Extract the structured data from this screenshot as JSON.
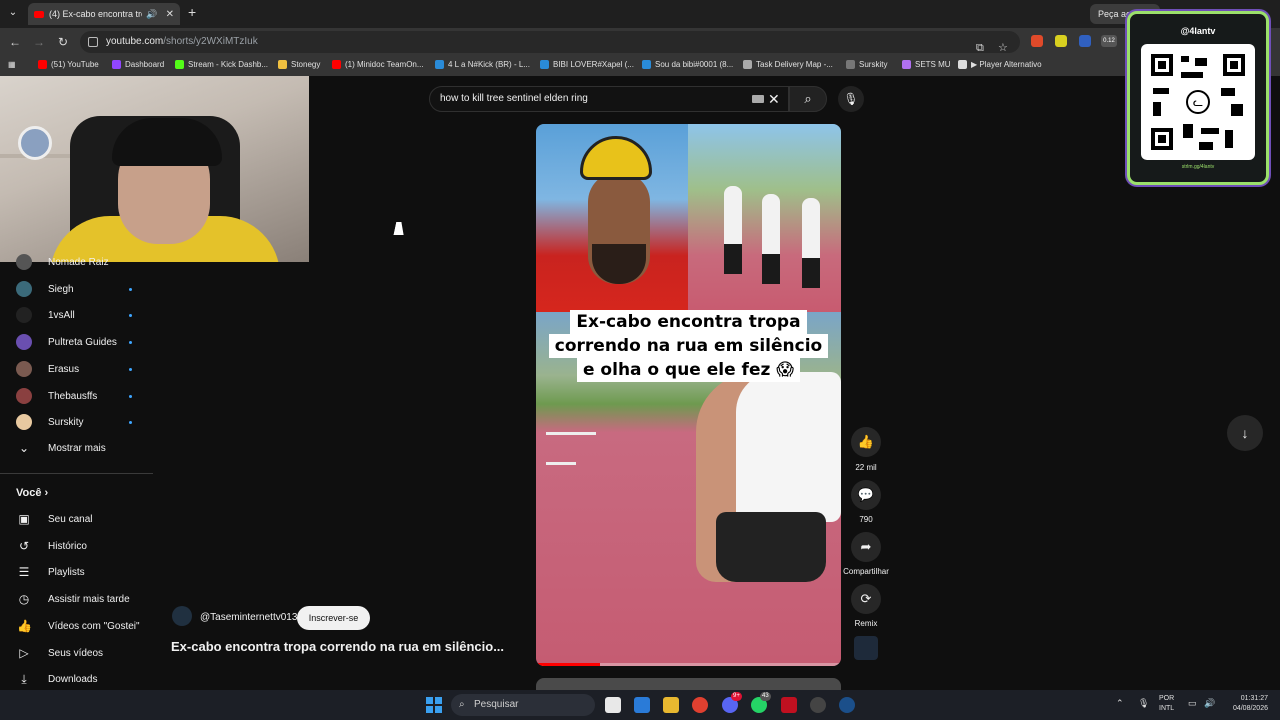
{
  "browser": {
    "active_tab_title": "(4) Ex-cabo encontra tropa",
    "right_tab_title": "Peça ao Gemini",
    "url_host": "youtube.com",
    "url_path": "/shorts/y2WXiMTzIuk",
    "extension_badge": "0.12"
  },
  "bookmarks": [
    {
      "label": "(51) YouTube",
      "color": "#ff0000"
    },
    {
      "label": "Dashboard",
      "color": "#9146ff"
    },
    {
      "label": "Stream - Kick Dashb...",
      "color": "#53fc18"
    },
    {
      "label": "Stonegy",
      "color": "#f0c040"
    },
    {
      "label": "(1) Minidoc TeamOn...",
      "color": "#ff0000"
    },
    {
      "label": "4 L a N#Kick (BR) - L...",
      "color": "#2a8bd8"
    },
    {
      "label": "BIBI LOVER#Xapel (...",
      "color": "#2a8bd8"
    },
    {
      "label": "Sou da bibi#0001 (8...",
      "color": "#2a8bd8"
    },
    {
      "label": "Task Delivery Map -...",
      "color": "#aaaaaa"
    },
    {
      "label": "Surskity",
      "color": "#777777"
    },
    {
      "label": "SETS MU",
      "color": "#b070f0"
    },
    {
      "label": "▶ Player Alternativo",
      "color": "#dddddd"
    }
  ],
  "search": {
    "query": "how to kill tree sentinel elden ring"
  },
  "sidebar": {
    "subscriptions": [
      {
        "name": "Nomade Raiz",
        "color": "#555555",
        "dot": false
      },
      {
        "name": "Siegh",
        "color": "#3b6a7a",
        "dot": true
      },
      {
        "name": "1vsAll",
        "color": "#222222",
        "dot": true
      },
      {
        "name": "Pultreta Guides",
        "color": "#6a4fb0",
        "dot": true
      },
      {
        "name": "Erasus",
        "color": "#7a5a50",
        "dot": true
      },
      {
        "name": "Thebausffs",
        "color": "#8a4040",
        "dot": true
      },
      {
        "name": "Surskity",
        "color": "#e8c9a0",
        "dot": true
      }
    ],
    "show_more": "Mostrar mais",
    "you_section": "Você",
    "you_items": [
      {
        "label": "Seu canal",
        "icon": "user-box-icon"
      },
      {
        "label": "Histórico",
        "icon": "history-icon"
      },
      {
        "label": "Playlists",
        "icon": "playlist-icon"
      },
      {
        "label": "Assistir mais tarde",
        "icon": "clock-icon"
      },
      {
        "label": "Vídeos com \"Gostei\"",
        "icon": "thumbs-up-icon"
      },
      {
        "label": "Seus vídeos",
        "icon": "play-box-icon"
      },
      {
        "label": "Downloads",
        "icon": "download-icon"
      }
    ]
  },
  "short": {
    "caption_lines": [
      "Ex-cabo encontra tropa",
      "correndo na rua em silêncio",
      "e olha o que ele fez 😱"
    ],
    "progress": 0.21,
    "channel": "@Taseminternettv013",
    "subscribe_label": "Inscrever-se",
    "title": "Ex-cabo encontra tropa correndo na rua em silêncio..."
  },
  "actions": {
    "likes": "22 mil",
    "comments": "790",
    "share": "Compartilhar",
    "remix": "Remix"
  },
  "overlay": {
    "handle": "@4lantv",
    "url": "strlm.gg/4lantv"
  },
  "taskbar": {
    "search_placeholder": "Pesquisar",
    "badge_discord": "9+",
    "badge_whatsapp": "43",
    "lang_line1": "POR",
    "lang_line2": "INTL",
    "time": "01:31:27",
    "date": "04/08/2026"
  }
}
